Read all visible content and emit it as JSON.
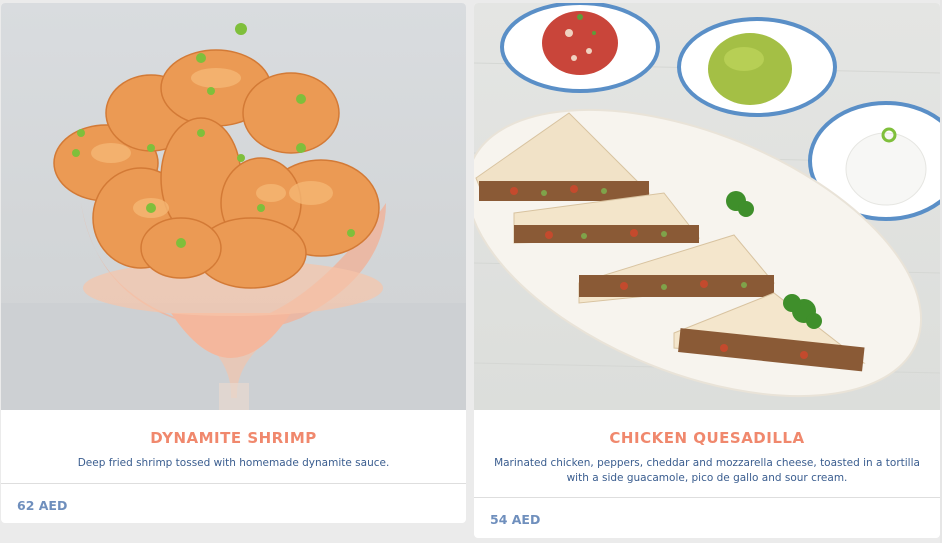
{
  "menu": {
    "items": [
      {
        "name": "DYNAMITE SHRIMP",
        "description": "Deep fried shrimp tossed with homemade dynamite sauce.",
        "price": "62 AED",
        "image_icon": "shrimp-cocktail-photo"
      },
      {
        "name": "CHICKEN QUESADILLA",
        "description": "Marinated chicken, peppers, cheddar and mozzarella cheese, toasted in a tortilla with a side guacamole, pico de gallo and sour cream.",
        "price": "54 AED",
        "image_icon": "quesadilla-plate-photo"
      }
    ]
  },
  "colors": {
    "title": "#f0886d",
    "description": "#3a5d8f",
    "price": "#6f8fbd",
    "card": "#ffffff",
    "page": "#ebebeb"
  }
}
